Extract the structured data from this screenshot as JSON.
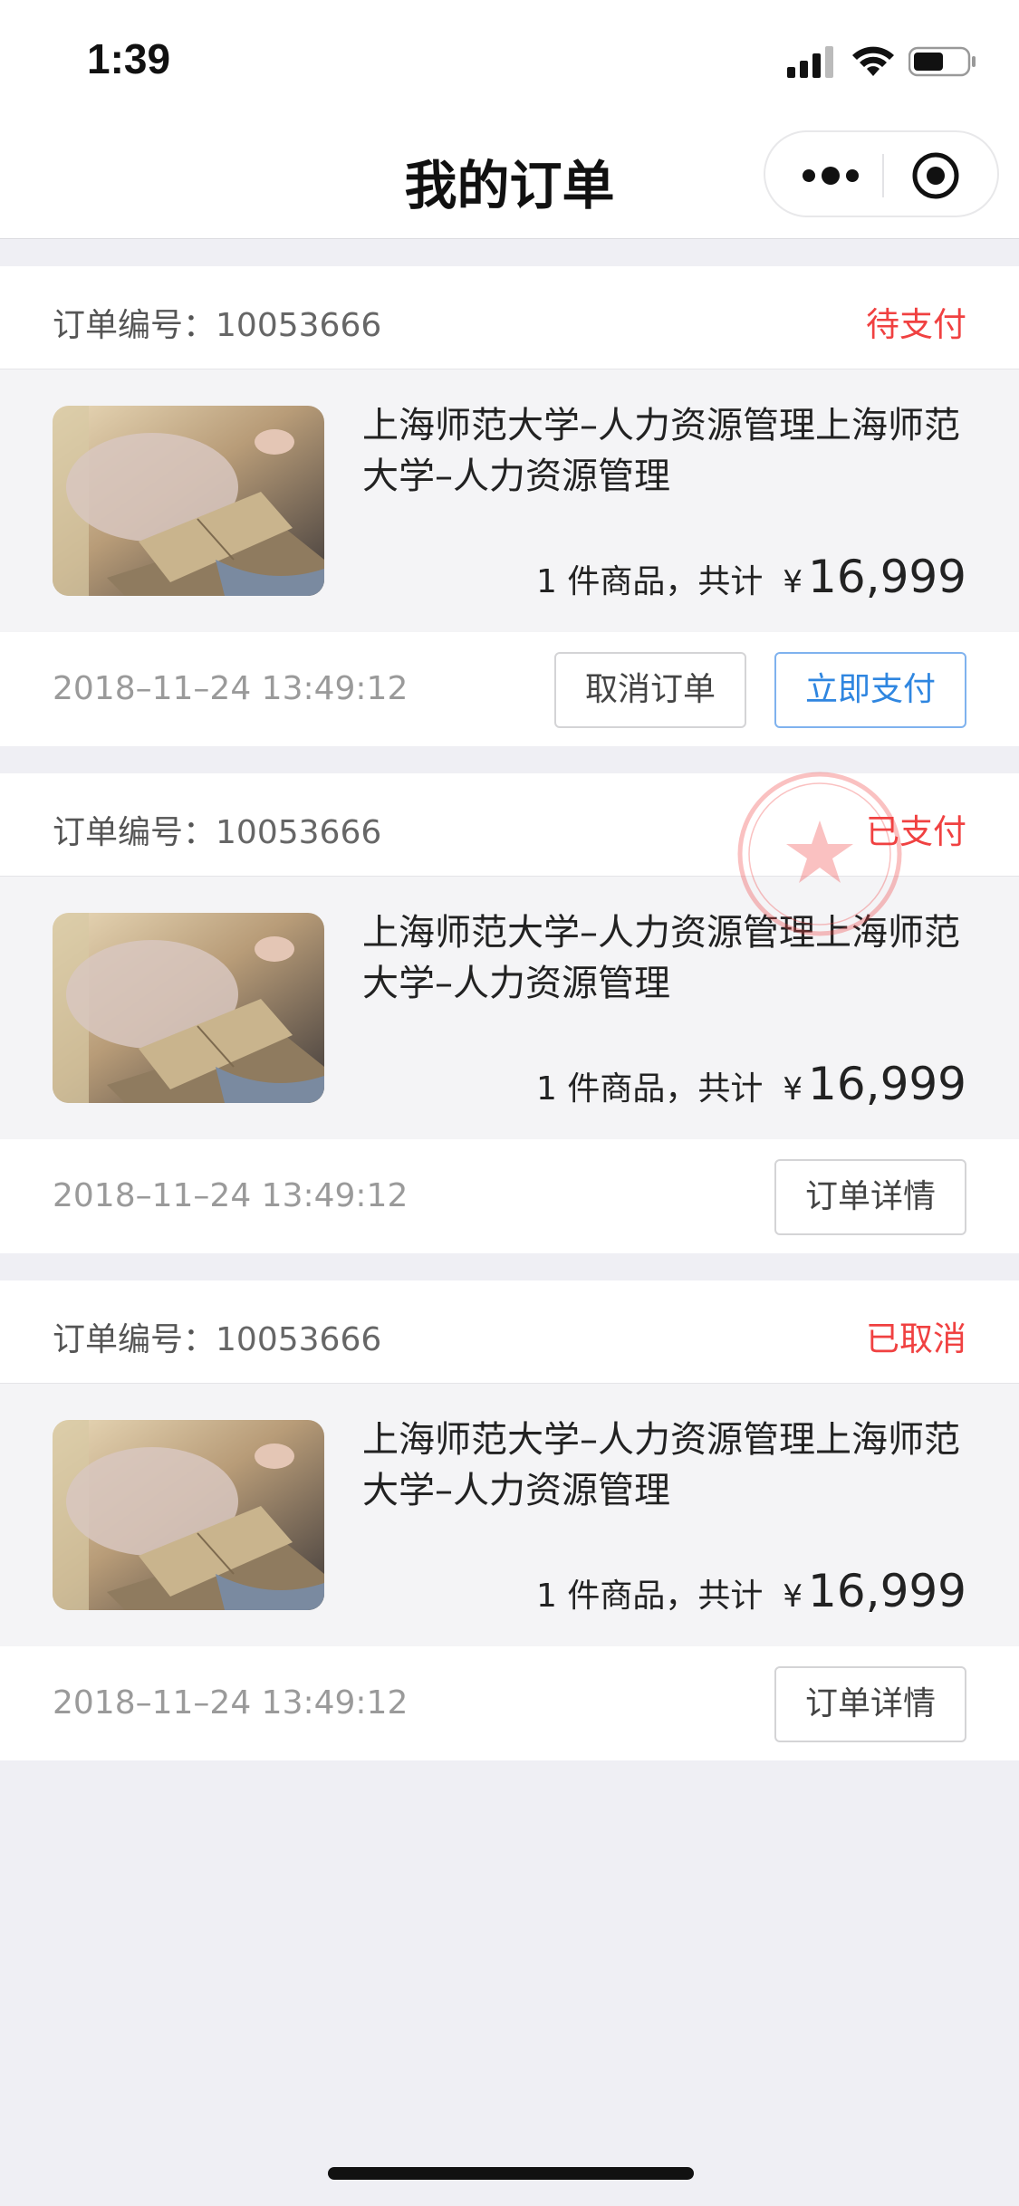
{
  "status_bar": {
    "time": "1:39"
  },
  "nav": {
    "title": "我的订单"
  },
  "orders": [
    {
      "label": "订单编号：",
      "number": "10053666",
      "status": "待支付",
      "product_title": "上海师范大学–人力资源管理上海师范大学–人力资源管理",
      "quantity_text": "1 件商品，共计",
      "currency": "¥",
      "price": "16,999",
      "time": "2018–11–24  13:49:12",
      "buttons": [
        "取消订单",
        "立即支付"
      ]
    },
    {
      "label": "订单编号：",
      "number": "10053666",
      "status": "已支付",
      "product_title": "上海师范大学–人力资源管理上海师范大学–人力资源管理",
      "quantity_text": "1 件商品，共计",
      "currency": "¥",
      "price": "16,999",
      "time": "2018–11–24  13:49:12",
      "buttons": [
        "订单详情"
      ]
    },
    {
      "label": "订单编号：",
      "number": "10053666",
      "status": "已取消",
      "product_title": "上海师范大学–人力资源管理上海师范大学–人力资源管理",
      "quantity_text": "1 件商品，共计",
      "currency": "¥",
      "price": "16,999",
      "time": "2018–11–24  13:49:12",
      "buttons": [
        "订单详情"
      ]
    }
  ],
  "colors": {
    "status_red": "#f04141",
    "primary_blue": "#2f86e0",
    "page_bg": "#efeff4"
  }
}
